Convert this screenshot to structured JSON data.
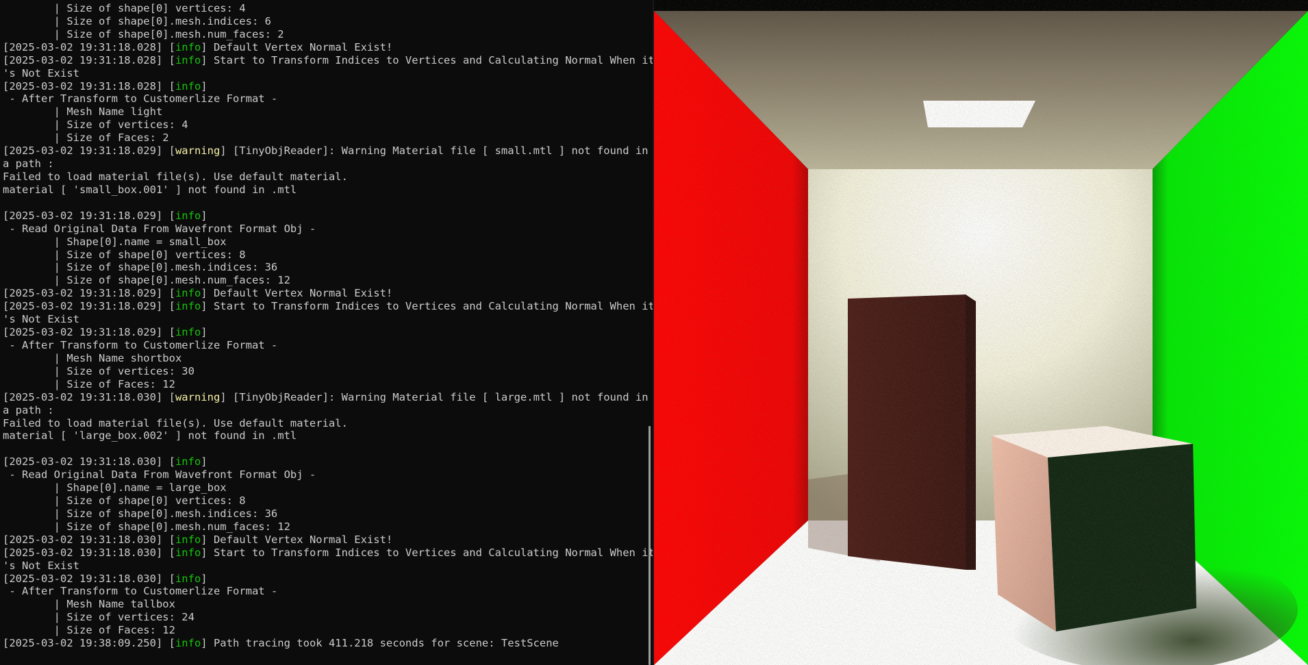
{
  "terminal": {
    "lines": [
      {
        "indent": "        ",
        "text": "| Size of shape[0] vertices: 4"
      },
      {
        "indent": "        ",
        "text": "| Size of shape[0].mesh.indices: 6"
      },
      {
        "indent": "        ",
        "text": "| Size of shape[0].mesh.num_faces: 2"
      },
      {
        "ts": "[2025-03-02 19:31:18.028]",
        "level": "info",
        "text": " Default Vertex Normal Exist!"
      },
      {
        "ts": "[2025-03-02 19:31:18.028]",
        "level": "info",
        "text": " Start to Transform Indices to Vertices and Calculating Normal When it"
      },
      {
        "text": "'s Not Exist"
      },
      {
        "ts": "[2025-03-02 19:31:18.028]",
        "level": "info",
        "text": ""
      },
      {
        "text": " - After Transform to Customerlize Format -"
      },
      {
        "indent": "        ",
        "text": "| Mesh Name light"
      },
      {
        "indent": "        ",
        "text": "| Size of vertices: 4"
      },
      {
        "indent": "        ",
        "text": "| Size of Faces: 2"
      },
      {
        "ts": "[2025-03-02 19:31:18.029]",
        "level": "warning",
        "text": " [TinyObjReader]: Warning Material file [ small.mtl ] not found in"
      },
      {
        "text": "a path :"
      },
      {
        "text": "Failed to load material file(s). Use default material."
      },
      {
        "text": "material [ 'small_box.001' ] not found in .mtl"
      },
      {
        "text": ""
      },
      {
        "ts": "[2025-03-02 19:31:18.029]",
        "level": "info",
        "text": ""
      },
      {
        "text": " - Read Original Data From Wavefront Format Obj -"
      },
      {
        "indent": "        ",
        "text": "| Shape[0].name = small_box"
      },
      {
        "indent": "        ",
        "text": "| Size of shape[0] vertices: 8"
      },
      {
        "indent": "        ",
        "text": "| Size of shape[0].mesh.indices: 36"
      },
      {
        "indent": "        ",
        "text": "| Size of shape[0].mesh.num_faces: 12"
      },
      {
        "ts": "[2025-03-02 19:31:18.029]",
        "level": "info",
        "text": " Default Vertex Normal Exist!"
      },
      {
        "ts": "[2025-03-02 19:31:18.029]",
        "level": "info",
        "text": " Start to Transform Indices to Vertices and Calculating Normal When it"
      },
      {
        "text": "'s Not Exist"
      },
      {
        "ts": "[2025-03-02 19:31:18.029]",
        "level": "info",
        "text": ""
      },
      {
        "text": " - After Transform to Customerlize Format -"
      },
      {
        "indent": "        ",
        "text": "| Mesh Name shortbox"
      },
      {
        "indent": "        ",
        "text": "| Size of vertices: 30"
      },
      {
        "indent": "        ",
        "text": "| Size of Faces: 12"
      },
      {
        "ts": "[2025-03-02 19:31:18.030]",
        "level": "warning",
        "text": " [TinyObjReader]: Warning Material file [ large.mtl ] not found in"
      },
      {
        "text": "a path :"
      },
      {
        "text": "Failed to load material file(s). Use default material."
      },
      {
        "text": "material [ 'large_box.002' ] not found in .mtl"
      },
      {
        "text": ""
      },
      {
        "ts": "[2025-03-02 19:31:18.030]",
        "level": "info",
        "text": ""
      },
      {
        "text": " - Read Original Data From Wavefront Format Obj -"
      },
      {
        "indent": "        ",
        "text": "| Shape[0].name = large_box"
      },
      {
        "indent": "        ",
        "text": "| Size of shape[0] vertices: 8"
      },
      {
        "indent": "        ",
        "text": "| Size of shape[0].mesh.indices: 36"
      },
      {
        "indent": "        ",
        "text": "| Size of shape[0].mesh.num_faces: 12"
      },
      {
        "ts": "[2025-03-02 19:31:18.030]",
        "level": "info",
        "text": " Default Vertex Normal Exist!"
      },
      {
        "ts": "[2025-03-02 19:31:18.030]",
        "level": "info",
        "text": " Start to Transform Indices to Vertices and Calculating Normal When it"
      },
      {
        "text": "'s Not Exist"
      },
      {
        "ts": "[2025-03-02 19:31:18.030]",
        "level": "info",
        "text": ""
      },
      {
        "text": " - After Transform to Customerlize Format -"
      },
      {
        "indent": "        ",
        "text": "| Mesh Name tallbox"
      },
      {
        "indent": "        ",
        "text": "| Size of vertices: 24"
      },
      {
        "indent": "        ",
        "text": "| Size of Faces: 12"
      },
      {
        "ts": "[2025-03-02 19:38:09.250]",
        "level": "info",
        "text": " Path tracing took 411.218 seconds for scene: TestScene"
      }
    ]
  },
  "colors": {
    "terminal_bg": "#0c0c0c",
    "terminal_text": "#cccccc",
    "info": "#16c60c",
    "warning": "#f9f1a5",
    "left_wall": "#ff0000",
    "right_wall": "#00ff00",
    "light": "#ffffff"
  },
  "render": {
    "icon": "cornell-box-render"
  }
}
